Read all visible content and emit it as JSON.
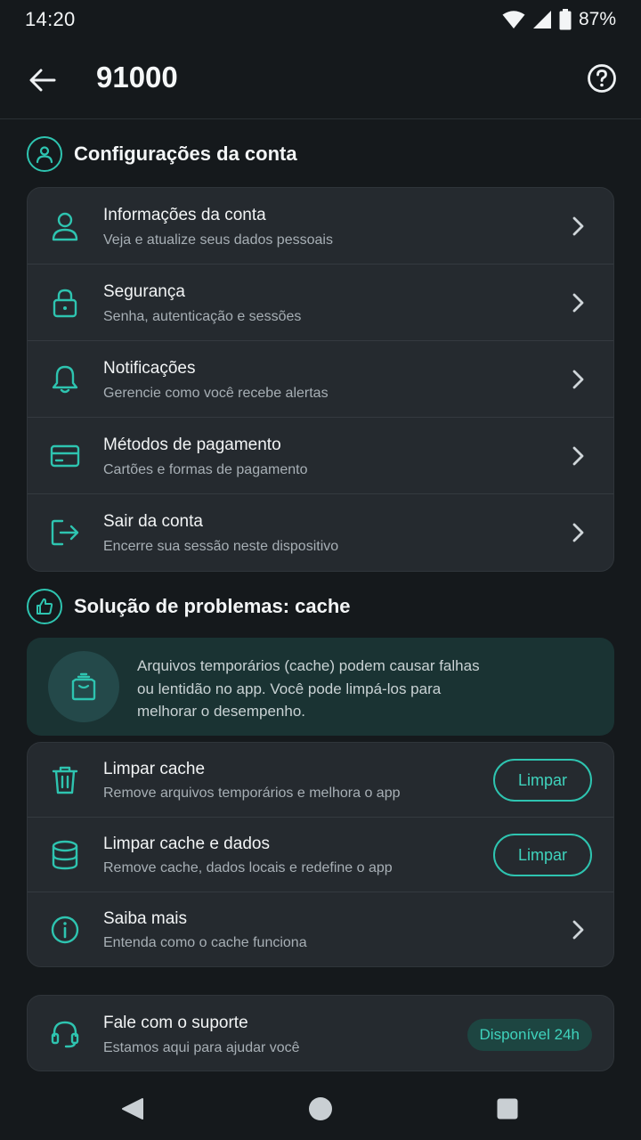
{
  "status": {
    "time": "14:20",
    "battery": "87%"
  },
  "app_bar": {
    "title": "91000",
    "back_icon": "arrow-left-icon",
    "help_icon": "help-circle-icon"
  },
  "account_section": {
    "title": "Configurações da conta",
    "icon": "user-circle-icon",
    "items": [
      {
        "title": "Informações da conta",
        "subtitle": "Veja e atualize seus dados pessoais",
        "icon": "user-icon"
      },
      {
        "title": "Segurança",
        "subtitle": "Senha, autenticação e sessões",
        "icon": "lock-icon"
      },
      {
        "title": "Notificações",
        "subtitle": "Gerencie como você recebe alertas",
        "icon": "bell-icon"
      },
      {
        "title": "Métodos de pagamento",
        "subtitle": "Cartões e formas de pagamento",
        "icon": "credit-card-icon"
      },
      {
        "title": "Sair da conta",
        "subtitle": "Encerre sua sessão neste dispositivo",
        "icon": "logout-icon"
      }
    ]
  },
  "cache_section": {
    "title": "Solução de problemas: cache",
    "icon": "thumbs-up-icon",
    "info_text": "Arquivos temporários (cache) podem causar falhas ou lentidão no app. Você pode limpá-los para melhorar o desempenho.",
    "items": [
      {
        "title": "Limpar cache",
        "subtitle": "Remove arquivos temporários e melhora o app",
        "button": "Limpar",
        "icon": "trash-icon"
      },
      {
        "title": "Limpar cache e dados",
        "subtitle": "Remove cache, dados locais e redefine o app",
        "button": "Limpar",
        "icon": "database-icon"
      },
      {
        "title": "Saiba mais",
        "subtitle": "Entenda como o cache funciona",
        "icon": "info-icon"
      }
    ]
  },
  "support": {
    "title": "Fale com o suporte",
    "subtitle": "Estamos aqui para ajudar você",
    "badge": "Disponível 24h",
    "icon": "headset-icon"
  },
  "colors": {
    "background": "#15191c",
    "card": "#252a2f",
    "accent": "#2ec4b0",
    "info_bg": "#1a3333"
  }
}
